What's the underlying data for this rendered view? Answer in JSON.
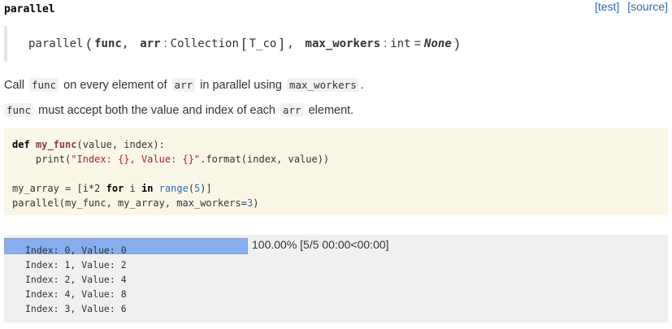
{
  "header": {
    "title": "parallel",
    "links": [
      "[test]",
      "[source]"
    ]
  },
  "signature": {
    "name": "parallel",
    "open_paren": "(",
    "param1": "func",
    "comma": ",",
    "param2": "arr",
    "colon": ":",
    "type2": "Collection",
    "lbracket": "[",
    "type2_arg": "T_co",
    "rbracket": "]",
    "param3": "max_workers",
    "type3": "int",
    "eq": "=",
    "default3": "None",
    "close_paren": ")"
  },
  "description": {
    "line1": {
      "t1": "Call",
      "c1": "func",
      "t2": "on every element of",
      "c2": "arr",
      "t3": "in parallel using",
      "c3": "max_workers",
      "t4": "."
    },
    "line2": {
      "c1": "func",
      "t1": "must accept both the value and index of each",
      "c2": "arr",
      "t2": "element."
    }
  },
  "code": {
    "l1_def": "def",
    "l1_name": "my_func",
    "l1_rest": "(value, index):",
    "l2_indent": "    ",
    "l2_print": "print",
    "l2_open": "(",
    "l2_str": "\"Index: {}, Value: {}\"",
    "l2_rest": ".format(index, value))",
    "l4_a": "my_array = [i*",
    "l4_num": "2",
    "l4_for": "for",
    "l4_i": " i ",
    "l4_in": "in",
    "l4_range": "range",
    "l4_b": "(",
    "l4_num2": "5",
    "l4_c": ")]",
    "l5_a": "parallel(my_func, my_array, max_workers=",
    "l5_num": "3",
    "l5_b": ")"
  },
  "output": {
    "progress_fraction": 1.0,
    "progress_text": "100.00% [5/5 00:00<00:00]",
    "lines": [
      "Index: 0, Value: 0",
      "Index: 1, Value: 2",
      "Index: 2, Value: 4",
      "Index: 4, Value: 8",
      "Index: 3, Value: 6"
    ]
  }
}
